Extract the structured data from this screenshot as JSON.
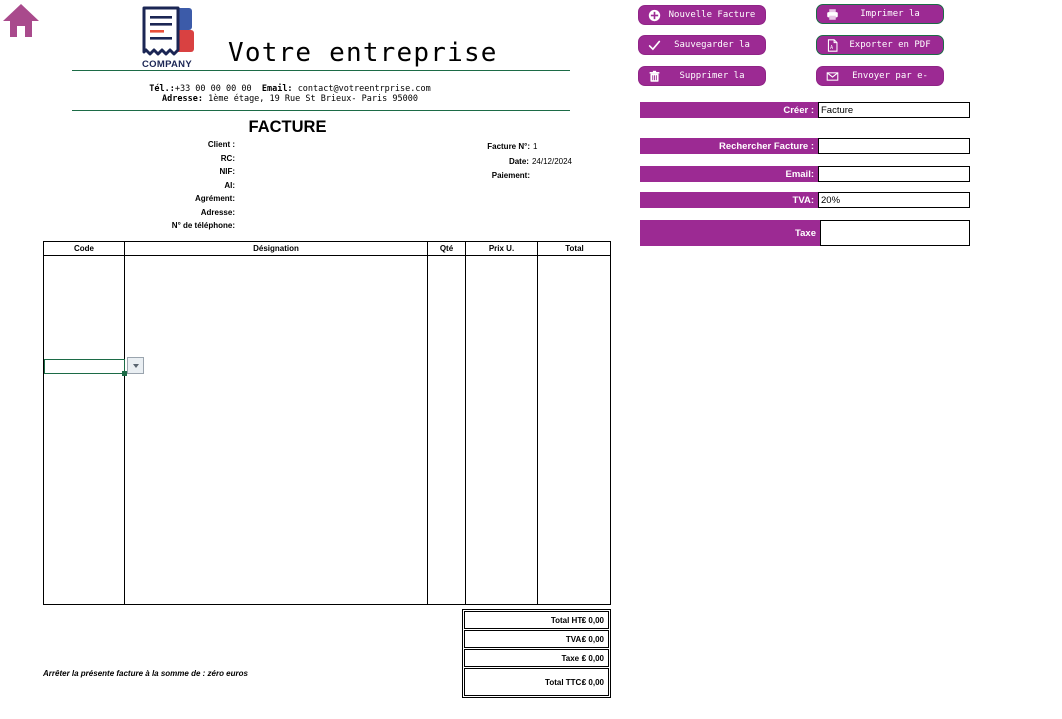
{
  "app": {
    "home_icon": "home-icon",
    "accent_purple": "#9C2A93",
    "accent_green": "#1C6B46"
  },
  "document": {
    "logo": {
      "word": "COMPANY",
      "icon": "invoice-document-icon"
    },
    "company_name": "Votre entreprise",
    "contact": {
      "phone_label": "Tél.:",
      "phone_value": "+33 00 00 00 00",
      "email_label": "Email:",
      "email_value": "contact@votreentrprise.com",
      "address_label": "Adresse:",
      "address_value": "1ème étage, 19 Rue St Brieux-  Paris 95000"
    },
    "title": "FACTURE",
    "client_fields": [
      {
        "label": "Client :",
        "value": ""
      },
      {
        "label": "RC:",
        "value": ""
      },
      {
        "label": "NIF:",
        "value": ""
      },
      {
        "label": "AI:",
        "value": ""
      },
      {
        "label": "Agrément:",
        "value": ""
      },
      {
        "label": "Adresse:",
        "value": ""
      },
      {
        "label": "N° de téléphone:",
        "value": ""
      }
    ],
    "meta_fields": [
      {
        "label": "Facture N°:",
        "value": "1"
      },
      {
        "label": "Date:",
        "value": "24/12/2024"
      },
      {
        "label": "Paiement:",
        "value": ""
      }
    ],
    "table": {
      "columns": [
        "Code",
        "Désignation",
        "Qté",
        "Prix U.",
        "Total"
      ],
      "rows": []
    },
    "totals": [
      {
        "label": "Total HT:",
        "value": "€ 0,00"
      },
      {
        "label": "TVA:",
        "value": "€ 0,00"
      },
      {
        "label": "Taxe :",
        "value": "€ 0,00"
      },
      {
        "label": "Total TTC:",
        "value": "€ 0,00"
      }
    ],
    "footer_note": "Arrêter la présente facture à la somme de : zéro euros"
  },
  "panel": {
    "buttons": [
      {
        "label": "Nouvelle Facture",
        "icon": "plus-circle-icon"
      },
      {
        "label": "Imprimer la",
        "icon": "printer-icon"
      },
      {
        "label": "Sauvegarder la",
        "icon": "check-icon"
      },
      {
        "label": "Exporter en PDF",
        "icon": "pdf-file-icon"
      },
      {
        "label": "Supprimer la",
        "icon": "trash-icon"
      },
      {
        "label": "Envoyer par e-",
        "icon": "envelope-icon"
      }
    ],
    "fields": [
      {
        "label": "Créer :",
        "value": "Facture"
      },
      {
        "label": "Rechercher Facture :",
        "value": ""
      },
      {
        "label": "Email:",
        "value": ""
      },
      {
        "label": "TVA:",
        "value": "20%"
      },
      {
        "label": "Taxe",
        "value": ""
      }
    ]
  }
}
